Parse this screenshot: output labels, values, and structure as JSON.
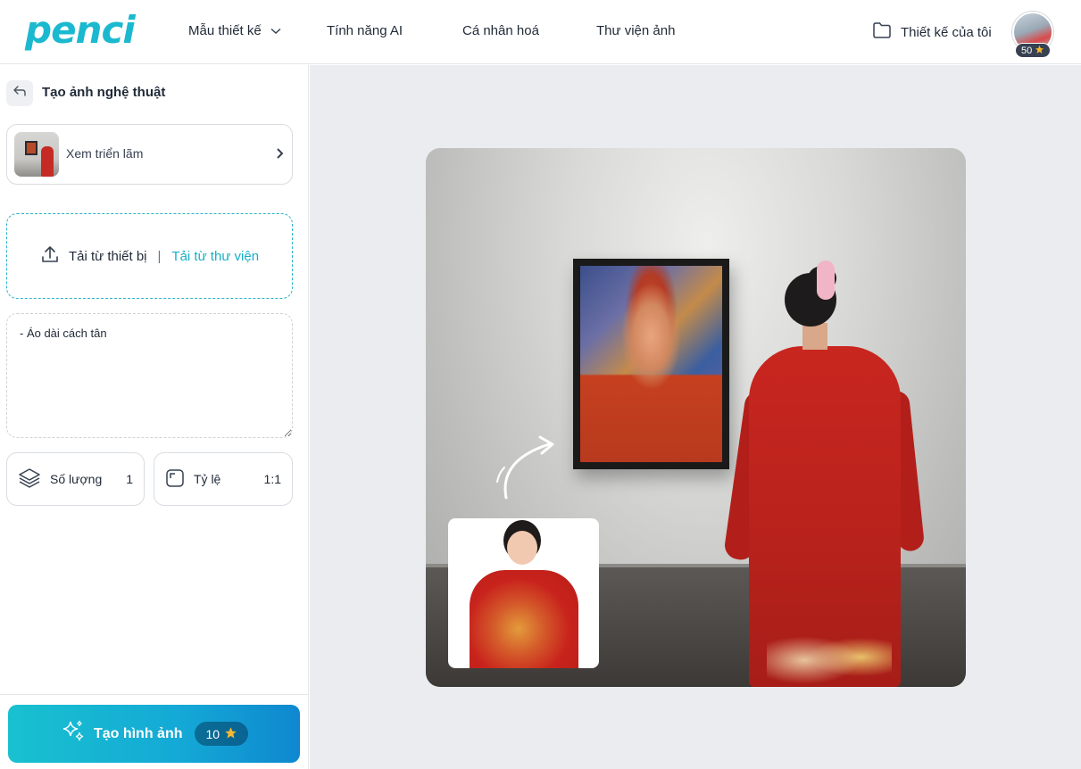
{
  "app": {
    "logo_text": "penci",
    "accent_color": "#16b0c6"
  },
  "nav": {
    "items": [
      {
        "label": "Mẫu thiết kế",
        "has_dropdown": true
      },
      {
        "label": "Tính năng AI"
      },
      {
        "label": "Cá nhân hoá"
      },
      {
        "label": "Thư viện ảnh"
      }
    ],
    "my_designs": "Thiết kế của tôi",
    "credits": "50"
  },
  "panel": {
    "title": "Tạo ảnh nghệ thuật",
    "exhibit_label": "Xem triển lãm",
    "upload_device": "Tải từ thiết bị",
    "upload_separator": "|",
    "upload_library": "Tải từ thư viện",
    "prompt_value": "- Áo dài cách tân",
    "quantity": {
      "label": "Số lượng",
      "value": "1"
    },
    "ratio": {
      "label": "Tỷ lệ",
      "value": "1:1"
    },
    "generate": {
      "label": "Tạo hình ảnh",
      "cost": "10"
    }
  },
  "icons": {
    "back": "back-arrow-icon",
    "folder": "folder-icon",
    "star": "star-icon",
    "upload": "upload-icon",
    "layers": "layers-icon",
    "aspect": "aspect-ratio-icon",
    "sparkle": "sparkle-icon"
  }
}
